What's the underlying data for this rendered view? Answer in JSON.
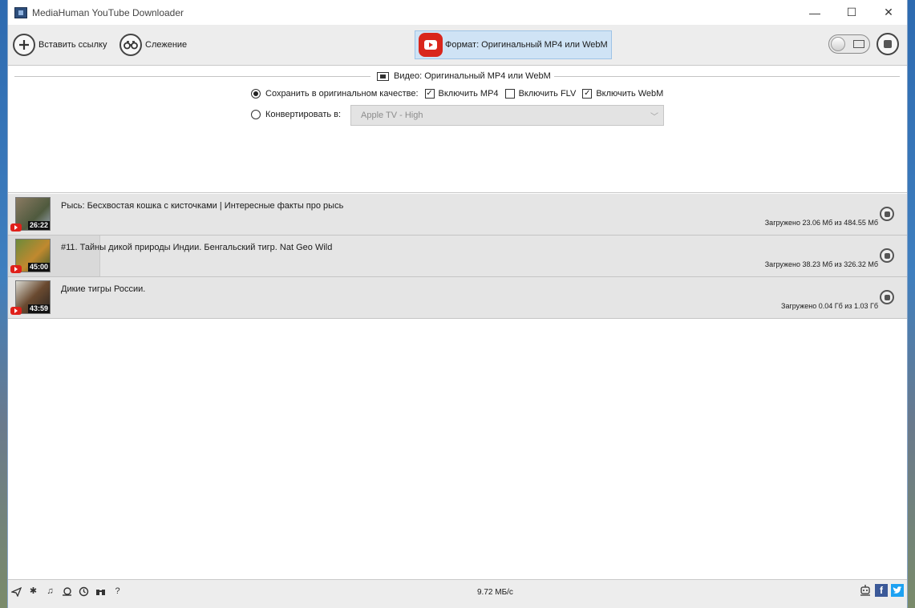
{
  "window": {
    "title": "MediaHuman YouTube Downloader",
    "minimize": "—",
    "maximize": "☐",
    "close": "✕"
  },
  "toolbar": {
    "paste_label": "Вставить ссылку",
    "track_label": "Слежение",
    "format_label": "Формат: Оригинальный MP4 или WebM"
  },
  "settings": {
    "section_title": "Видео: Оригинальный MP4 или WebM",
    "save_original_label": "Сохранить в оригинальном качестве:",
    "include_mp4": "Включить MP4",
    "include_flv": "Включить FLV",
    "include_webm": "Включить WebM",
    "mp4_checked": true,
    "flv_checked": false,
    "webm_checked": true,
    "convert_label": "Конвертировать в:",
    "convert_value": "Apple TV - High"
  },
  "downloads": [
    {
      "title": "Рысь: Бесхвостая кошка с кисточками | Интересные факты про рысь",
      "duration": "26:22",
      "status": "Загружено 23.06 Мб из 484.55 Мб",
      "progress": 0.048
    },
    {
      "title": "#11. Тайны дикой природы Индии. Бенгальский тигр. Nat Geo Wild",
      "duration": "45:00",
      "status": "Загружено 38.23 Мб из 326.32 Мб",
      "progress": 0.117
    },
    {
      "title": "Дикие тигры России.",
      "duration": "43:59",
      "status": "Загружено 0.04 Гб из 1.03 Гб",
      "progress": 0.039
    }
  ],
  "statusbar": {
    "speed": "9.72 МБ/с",
    "facebook": "f",
    "help": "?"
  },
  "colors": {
    "youtube_red": "#d9261c",
    "format_highlight": "#cfe3f5",
    "facebook_blue": "#3b5998",
    "twitter_blue": "#1da1f2"
  }
}
